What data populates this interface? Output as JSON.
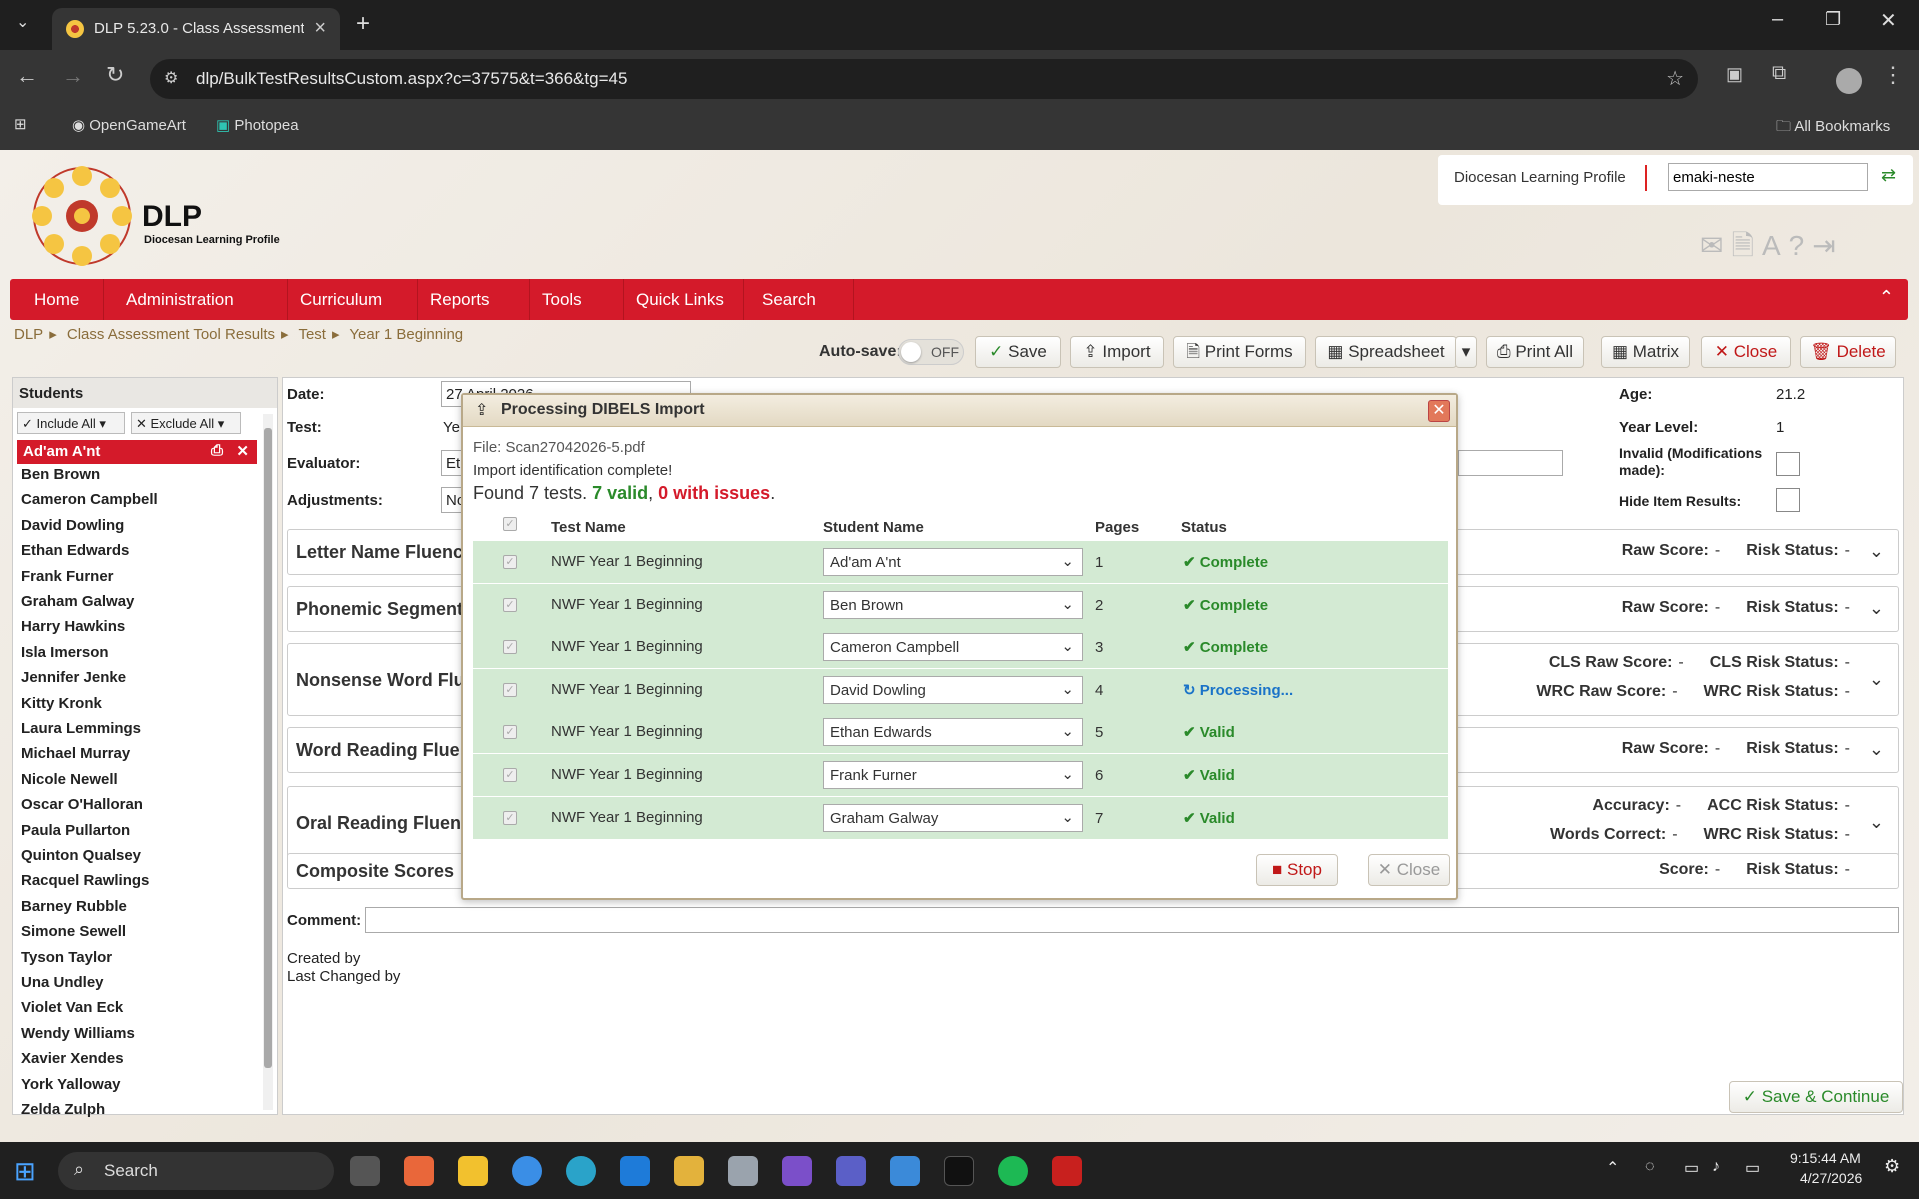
{
  "browser": {
    "tab_title": "DLP 5.23.0 - Class Assessment T",
    "url": "dlp/BulkTestResultsCustom.aspx?c=37575&t=366&tg=45",
    "bookmarks": [
      "OpenGameArt",
      "Photopea"
    ],
    "all_bookmarks": "All Bookmarks"
  },
  "header": {
    "logo_title": "DLP",
    "logo_sub": "Diocesan Learning Profile",
    "site_label": "Diocesan Learning Profile",
    "user_value": "emaki-neste"
  },
  "menu": [
    "Home",
    "Administration",
    "Curriculum",
    "Reports",
    "Tools",
    "Quick Links",
    "Search"
  ],
  "breadcrumb": [
    "DLP",
    "Class Assessment Tool Results",
    "Test",
    "Year 1 Beginning"
  ],
  "toolbar": {
    "autosave_label": "Auto-save:",
    "autosave_state": "OFF",
    "save": "Save",
    "import": "Import",
    "print_forms": "Print Forms",
    "spreadsheet": "Spreadsheet",
    "print_all": "Print All",
    "matrix": "Matrix",
    "close": "Close",
    "delete": "Delete"
  },
  "students": {
    "title": "Students",
    "include_all": "Include All",
    "exclude_all": "Exclude All",
    "selected": "Ad'am A'nt",
    "list": [
      "Ben Brown",
      "Cameron Campbell",
      "David Dowling",
      "Ethan Edwards",
      "Frank Furner",
      "Graham Galway",
      "Harry Hawkins",
      "Isla Imerson",
      "Jennifer Jenke",
      "Kitty Kronk",
      "Laura Lemmings",
      "Michael Murray",
      "Nicole Newell",
      "Oscar O'Halloran",
      "Paula Pullarton",
      "Quinton Qualsey",
      "Racquel Rawlings",
      "Barney Rubble",
      "Simone Sewell",
      "Tyson Taylor",
      "Una Undley",
      "Violet Van Eck",
      "Wendy Williams",
      "Xavier Xendes",
      "York Yalloway",
      "Zelda Zulph"
    ]
  },
  "form": {
    "date_label": "Date:",
    "date_value": "27 April 2026",
    "test_label": "Test:",
    "test_value": "Ye",
    "evaluator_label": "Evaluator:",
    "evaluator_value": "Et",
    "adjustments_label": "Adjustments:",
    "adjustments_value": "No",
    "age_label": "Age:",
    "age_value": "21.2",
    "year_label": "Year Level:",
    "year_value": "1",
    "invalid_label_1": "Invalid (Modifications",
    "invalid_label_2": "made):",
    "hide_label": "Hide Item Results:",
    "comment_label": "Comment:",
    "created_by": "Created by",
    "changed_by": "Last Changed by",
    "save_continue": "Save & Continue"
  },
  "sections": [
    {
      "title": "Letter Name Fluenc",
      "right": [
        "Raw Score:",
        "-",
        "Risk Status:",
        "-"
      ]
    },
    {
      "title": "Phonemic Segment",
      "right": [
        "Raw Score:",
        "-",
        "Risk Status:",
        "-"
      ]
    },
    {
      "title": "Nonsense Word Flu",
      "right1": [
        "CLS Raw Score:",
        "-",
        "CLS Risk Status:",
        "-"
      ],
      "right2": [
        "WRC Raw Score:",
        "-",
        "WRC Risk Status:",
        "-"
      ]
    },
    {
      "title": "Word Reading Flue",
      "right": [
        "Raw Score:",
        "-",
        "Risk Status:",
        "-"
      ]
    },
    {
      "title": "Oral Reading Fluen",
      "right1": [
        "Accuracy:",
        "-",
        "ACC Risk Status:",
        "-"
      ],
      "right2": [
        "Words Correct:",
        "-",
        "WRC Risk Status:",
        "-"
      ]
    },
    {
      "title": "Composite Scores",
      "right": [
        "Score:",
        "-",
        "Risk Status:",
        "-"
      ]
    }
  ],
  "modal": {
    "title": "Processing DIBELS Import",
    "file": "File: Scan27042026-5.pdf",
    "ident": "Import identification complete!",
    "found_pre": "Found 7 tests.",
    "found_valid": "7 valid",
    "found_issues": "0 with issues",
    "headers": [
      "Test Name",
      "Student Name",
      "Pages",
      "Status"
    ],
    "rows": [
      {
        "test": "NWF Year 1 Beginning",
        "student": "Ad'am A'nt",
        "pages": "1",
        "status": "Complete",
        "state": "done"
      },
      {
        "test": "NWF Year 1 Beginning",
        "student": "Ben Brown",
        "pages": "2",
        "status": "Complete",
        "state": "done"
      },
      {
        "test": "NWF Year 1 Beginning",
        "student": "Cameron Campbell",
        "pages": "3",
        "status": "Complete",
        "state": "done"
      },
      {
        "test": "NWF Year 1 Beginning",
        "student": "David Dowling",
        "pages": "4",
        "status": "Processing...",
        "state": "processing"
      },
      {
        "test": "NWF Year 1 Beginning",
        "student": "Ethan Edwards",
        "pages": "5",
        "status": "Valid",
        "state": "done"
      },
      {
        "test": "NWF Year 1 Beginning",
        "student": "Frank Furner",
        "pages": "6",
        "status": "Valid",
        "state": "done"
      },
      {
        "test": "NWF Year 1 Beginning",
        "student": "Graham Galway",
        "pages": "7",
        "status": "Valid",
        "state": "done"
      }
    ],
    "stop": "Stop",
    "close": "Close"
  },
  "taskbar": {
    "search": "Search",
    "time": "9:15:44 AM",
    "date": "4/27/2026"
  },
  "colors": {
    "brand_red": "#d41a2a",
    "valid_green": "#2a8a2a",
    "issue_red": "#d41a2a",
    "processing_blue": "#1a73c8"
  }
}
